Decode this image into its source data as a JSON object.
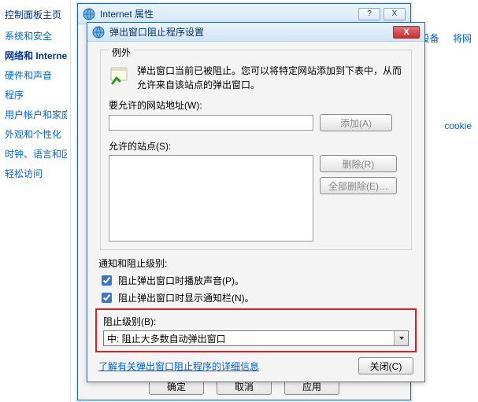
{
  "sidebar": {
    "title": "控制面板主页",
    "items": [
      {
        "label": "系统和安全"
      },
      {
        "label": "网络和 Internet"
      },
      {
        "label": "硬件和声音"
      },
      {
        "label": "程序"
      },
      {
        "label": "用户帐户和家庭安"
      },
      {
        "label": "外观和个性化"
      },
      {
        "label": "时钟、语言和区域"
      },
      {
        "label": "轻松访问"
      }
    ]
  },
  "topright": {
    "a": "设备",
    "b": "将网",
    "c": "cookie"
  },
  "parent": {
    "title": "Internet 属性",
    "help": "?",
    "close": "X",
    "ok": "确定",
    "cancel": "取消",
    "apply": "应用"
  },
  "dlg": {
    "title": "弹出窗口阻止程序设置",
    "close": "X",
    "group": "例外",
    "info": "弹出窗口当前已被阻止。您可以将特定网站添加到下表中，从而允许来自该站点的弹出窗口。",
    "url_label": "要允许的网站地址(W):",
    "url_value": "",
    "add_btn": "添加(A)",
    "allowed_label": "允许的站点(S):",
    "remove_btn": "删除(R)",
    "remove_all_btn": "全部删除(E)…",
    "notif_title": "通知和阻止级别:",
    "chk1": "阻止弹出窗口时播放声音(P)。",
    "chk2": "阻止弹出窗口时显示通知栏(N)。",
    "level_label": "阻止级别(B):",
    "level_value": "中: 阻止大多数自动弹出窗口",
    "more_link": "了解有关弹出窗口阻止程序的详细信息",
    "close_btn": "关闭(C)"
  }
}
